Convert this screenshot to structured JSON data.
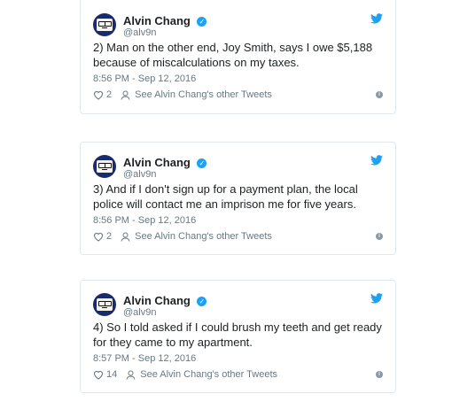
{
  "tweets": [
    {
      "name": "Alvin Chang",
      "handle": "@alv9n",
      "text": "2) Man on the other end, Joy Smith, says I owe $5,188 because of miscalculations on my taxes.",
      "time": "8:56 PM - Sep 12, 2016",
      "likes": "2",
      "other_link": "See Alvin Chang's other Tweets"
    },
    {
      "name": "Alvin Chang",
      "handle": "@alv9n",
      "text": "3) And if I don't sign up for a payment plan, the local police will contact me an imprison me for five years.",
      "time": "8:56 PM - Sep 12, 2016",
      "likes": "2",
      "other_link": "See Alvin Chang's other Tweets"
    },
    {
      "name": "Alvin Chang",
      "handle": "@alv9n",
      "text": "4) So I told asked if I could brush my teeth and get ready for they came to my apartment.",
      "time": "8:57 PM - Sep 12, 2016",
      "likes": "14",
      "other_link": "See Alvin Chang's other Tweets"
    }
  ],
  "colors": {
    "accent": "#1da1f2",
    "muted": "#697882",
    "border": "#e1e8ed"
  },
  "icons": [
    "verified-badge-icon",
    "twitter-bird-icon",
    "heart-icon",
    "person-icon",
    "info-icon"
  ]
}
